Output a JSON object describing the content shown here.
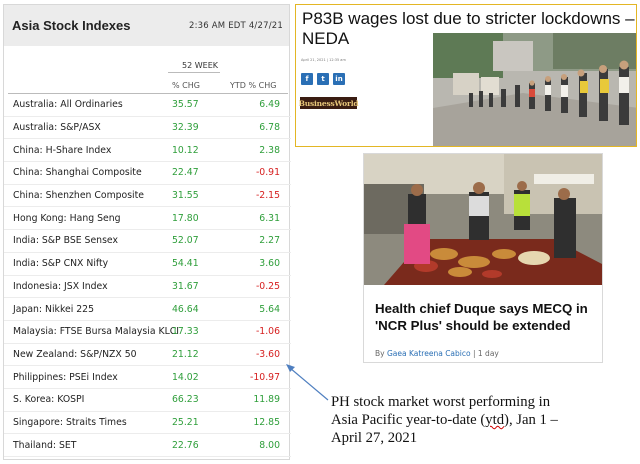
{
  "stock_table": {
    "title": "Asia Stock Indexes",
    "timestamp": "2:36 AM EDT 4/27/21",
    "period_label": "52 WEEK",
    "col_chg": "% CHG",
    "col_ytd": "YTD % CHG",
    "rows": [
      {
        "name": "Australia: All Ordinaries",
        "chg": "35.57",
        "ytd": "6.49"
      },
      {
        "name": "Australia: S&P/ASX",
        "chg": "32.39",
        "ytd": "6.78"
      },
      {
        "name": "China: H-Share Index",
        "chg": "10.12",
        "ytd": "2.38"
      },
      {
        "name": "China: Shanghai Composite",
        "chg": "22.47",
        "ytd": "-0.91"
      },
      {
        "name": "China: Shenzhen Composite",
        "chg": "31.55",
        "ytd": "-2.15"
      },
      {
        "name": "Hong Kong: Hang Seng",
        "chg": "17.80",
        "ytd": "6.31"
      },
      {
        "name": "India: S&P BSE Sensex",
        "chg": "52.07",
        "ytd": "2.27"
      },
      {
        "name": "India: S&P CNX Nifty",
        "chg": "54.41",
        "ytd": "3.60"
      },
      {
        "name": "Indonesia: JSX Index",
        "chg": "31.67",
        "ytd": "-0.25"
      },
      {
        "name": "Japan: Nikkei 225",
        "chg": "46.64",
        "ytd": "5.64"
      },
      {
        "name": "Malaysia: FTSE Bursa Malaysia KLCI",
        "chg": "17.33",
        "ytd": "-1.06"
      },
      {
        "name": "New Zealand: S&P/NZX 50",
        "chg": "21.12",
        "ytd": "-3.60"
      },
      {
        "name": "Philippines: PSEi Index",
        "chg": "14.02",
        "ytd": "-10.97"
      },
      {
        "name": "S. Korea: KOSPI",
        "chg": "66.23",
        "ytd": "11.89"
      },
      {
        "name": "Singapore: Straits Times",
        "chg": "25.21",
        "ytd": "12.85"
      },
      {
        "name": "Thailand: SET",
        "chg": "22.76",
        "ytd": "8.00"
      }
    ]
  },
  "news1": {
    "headline": "P83B wages lost due to stricter lockdowns – NEDA",
    "date": "April 21, 2021 | 12:35 am",
    "share_facebook": "f",
    "share_twitter": "t",
    "share_linkedin": "in",
    "publisher": "BusinessWorld"
  },
  "news2": {
    "headline": "Health chief Duque says MECQ in 'NCR Plus' should be extended",
    "byline_prefix": "By",
    "author": "Gaea Katreena Cabico",
    "byline_sep": "|",
    "age": "1 day"
  },
  "annotation": {
    "line1": "PH stock market worst performing in",
    "line2_a": "Asia Pacific year-to-date (",
    "line2_ytd": "ytd",
    "line2_b": "), Jan 1 –",
    "line3": "April 27, 2021"
  },
  "colors": {
    "positive": "#2e9e3a",
    "negative": "#d62020",
    "card_border": "#e3b624",
    "link_blue": "#2a6fb5",
    "arrow": "#4f7fc0"
  }
}
